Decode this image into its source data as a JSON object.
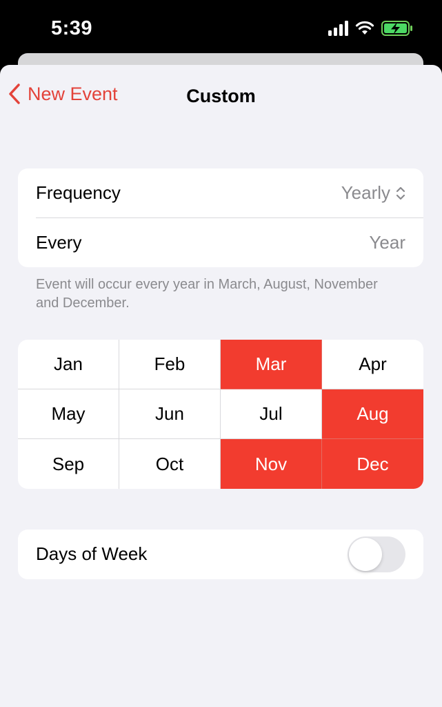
{
  "status_bar": {
    "time": "5:39"
  },
  "nav": {
    "back_label": "New Event",
    "title": "Custom"
  },
  "frequency_card": {
    "frequency_label": "Frequency",
    "frequency_value": "Yearly",
    "every_label": "Every",
    "every_value": "Year"
  },
  "footnote": "Event will occur every year in March, August, November and December.",
  "months": [
    {
      "label": "Jan",
      "selected": false
    },
    {
      "label": "Feb",
      "selected": false
    },
    {
      "label": "Mar",
      "selected": true
    },
    {
      "label": "Apr",
      "selected": false
    },
    {
      "label": "May",
      "selected": false
    },
    {
      "label": "Jun",
      "selected": false
    },
    {
      "label": "Jul",
      "selected": false
    },
    {
      "label": "Aug",
      "selected": true
    },
    {
      "label": "Sep",
      "selected": false
    },
    {
      "label": "Oct",
      "selected": false
    },
    {
      "label": "Nov",
      "selected": true
    },
    {
      "label": "Dec",
      "selected": true
    }
  ],
  "days_of_week": {
    "label": "Days of Week",
    "enabled": false
  },
  "colors": {
    "accent": "#f23c2f",
    "background": "#f2f2f7",
    "secondary_text": "#8a8a8e"
  },
  "icons": [
    "signal-icon",
    "wifi-icon",
    "battery-charging-icon",
    "chevron-left-icon",
    "chevron-up-down-icon"
  ]
}
